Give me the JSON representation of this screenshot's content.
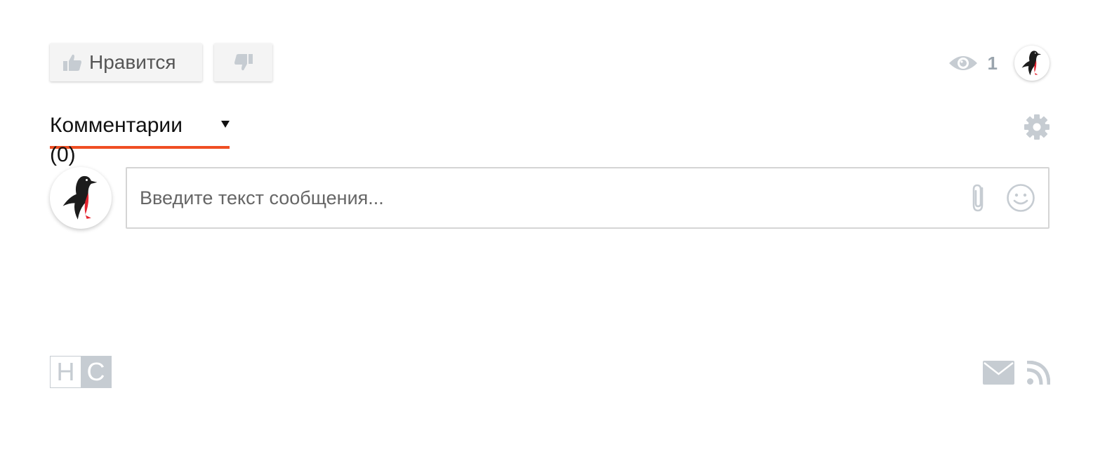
{
  "reactions": {
    "like_label": "Нравится",
    "like_icon": "thumbs-up-icon",
    "dislike_icon": "thumbs-down-icon"
  },
  "stats": {
    "views_icon": "eye-icon",
    "views_count": "1",
    "author_avatar": "penguin-avatar"
  },
  "comments": {
    "tab_label": "Комментарии (0)",
    "settings_icon": "gear-icon"
  },
  "compose": {
    "placeholder": "Введите текст сообщения...",
    "attach_icon": "paperclip-icon",
    "emoji_icon": "smiley-icon"
  },
  "footer": {
    "logo_left": "H",
    "logo_right": "C",
    "mail_icon": "mail-icon",
    "rss_icon": "rss-icon"
  },
  "colors": {
    "accent": "#f04e23",
    "icon_gray": "#c6ccd2",
    "text_gray": "#9aa4ad"
  }
}
